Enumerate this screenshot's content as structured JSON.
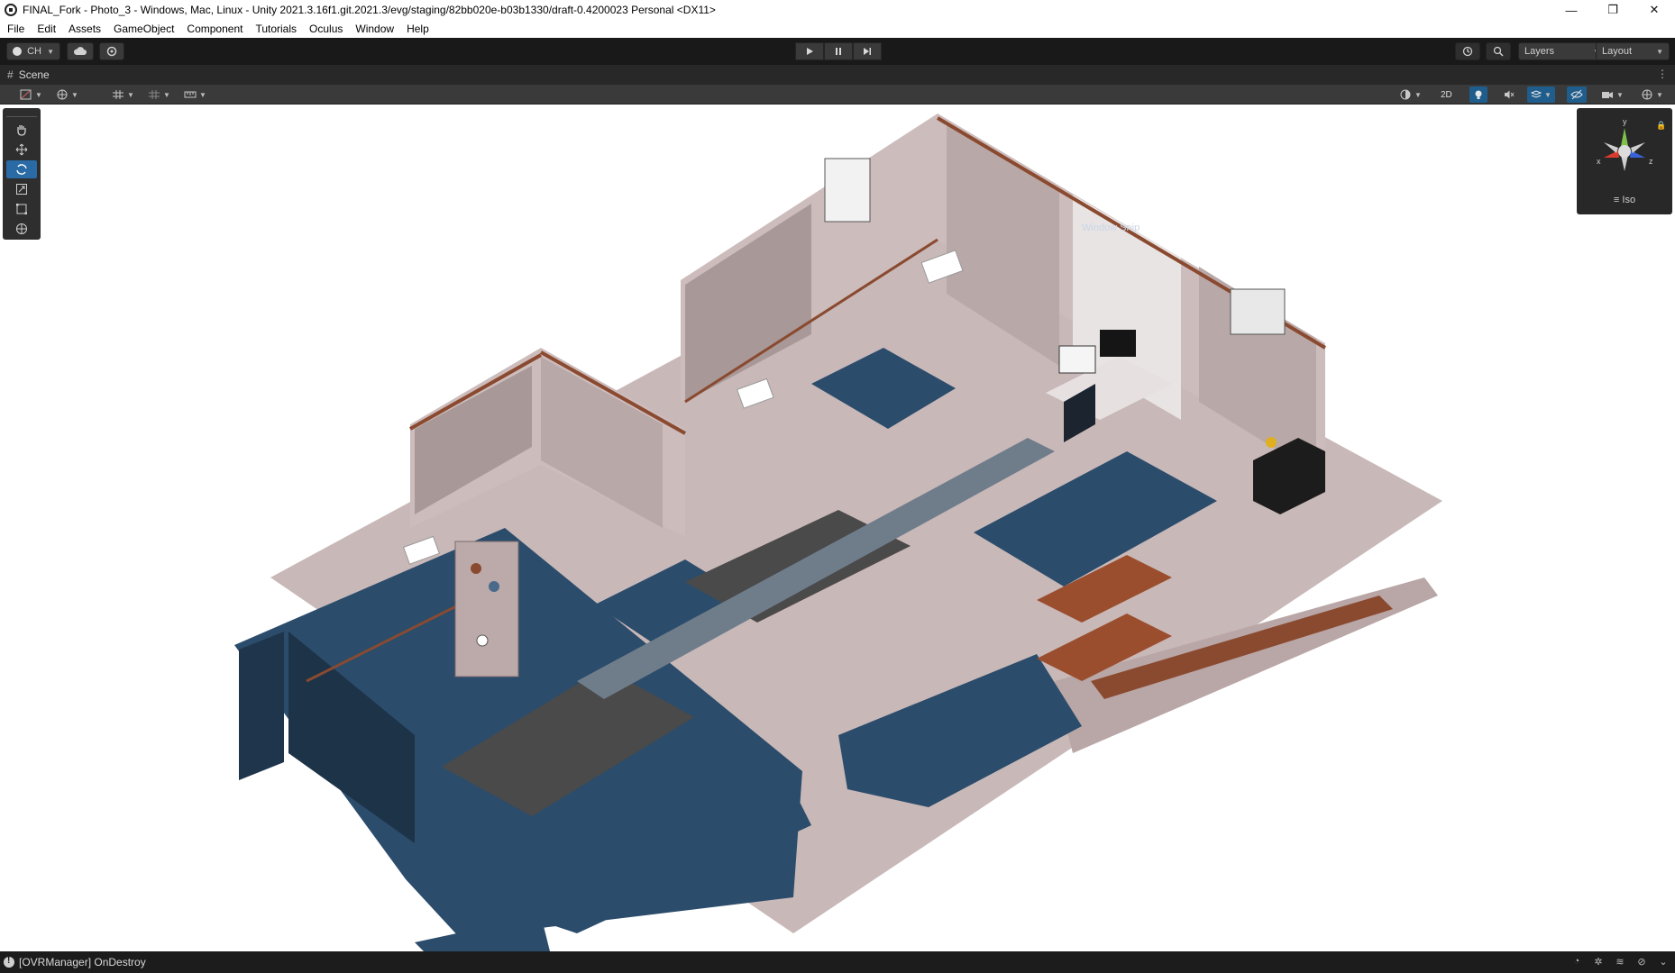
{
  "window": {
    "title": "FINAL_Fork - Photo_3 - Windows, Mac, Linux - Unity 2021.3.16f1.git.2021.3/evg/staging/82bb020e-b03b1330/draft-0.4200023 Personal <DX11>",
    "minimize_glyph": "—",
    "maximize_glyph": "❐",
    "close_glyph": "✕"
  },
  "menu": {
    "items": [
      "File",
      "Edit",
      "Assets",
      "GameObject",
      "Component",
      "Tutorials",
      "Oculus",
      "Window",
      "Help"
    ]
  },
  "toolbar": {
    "account_label": "CH",
    "layers_label": "Layers",
    "layout_label": "Layout",
    "play_icon": "play-icon",
    "pause_icon": "pause-icon",
    "step_icon": "step-icon"
  },
  "scene_tab": {
    "label": "Scene"
  },
  "scene_toolbar": {
    "view_2d_label": "2D"
  },
  "scene": {
    "sign_text": "Window Snip"
  },
  "gizmo": {
    "projection_label": "Iso",
    "axis_y": "y",
    "axis_x": "x",
    "axis_z": "z"
  },
  "statusbar": {
    "message": "[OVRManager] OnDestroy"
  },
  "colors": {
    "toolbar_bg": "#191919",
    "scene_tab_bg": "#282828",
    "scene_toolbar_bg": "#3a3a3a",
    "active_blue": "#2a6ba6",
    "hull_blue": "#2b4c6b",
    "hull_pink": "#d7c6c6",
    "trim_copper": "#8a4a30"
  }
}
